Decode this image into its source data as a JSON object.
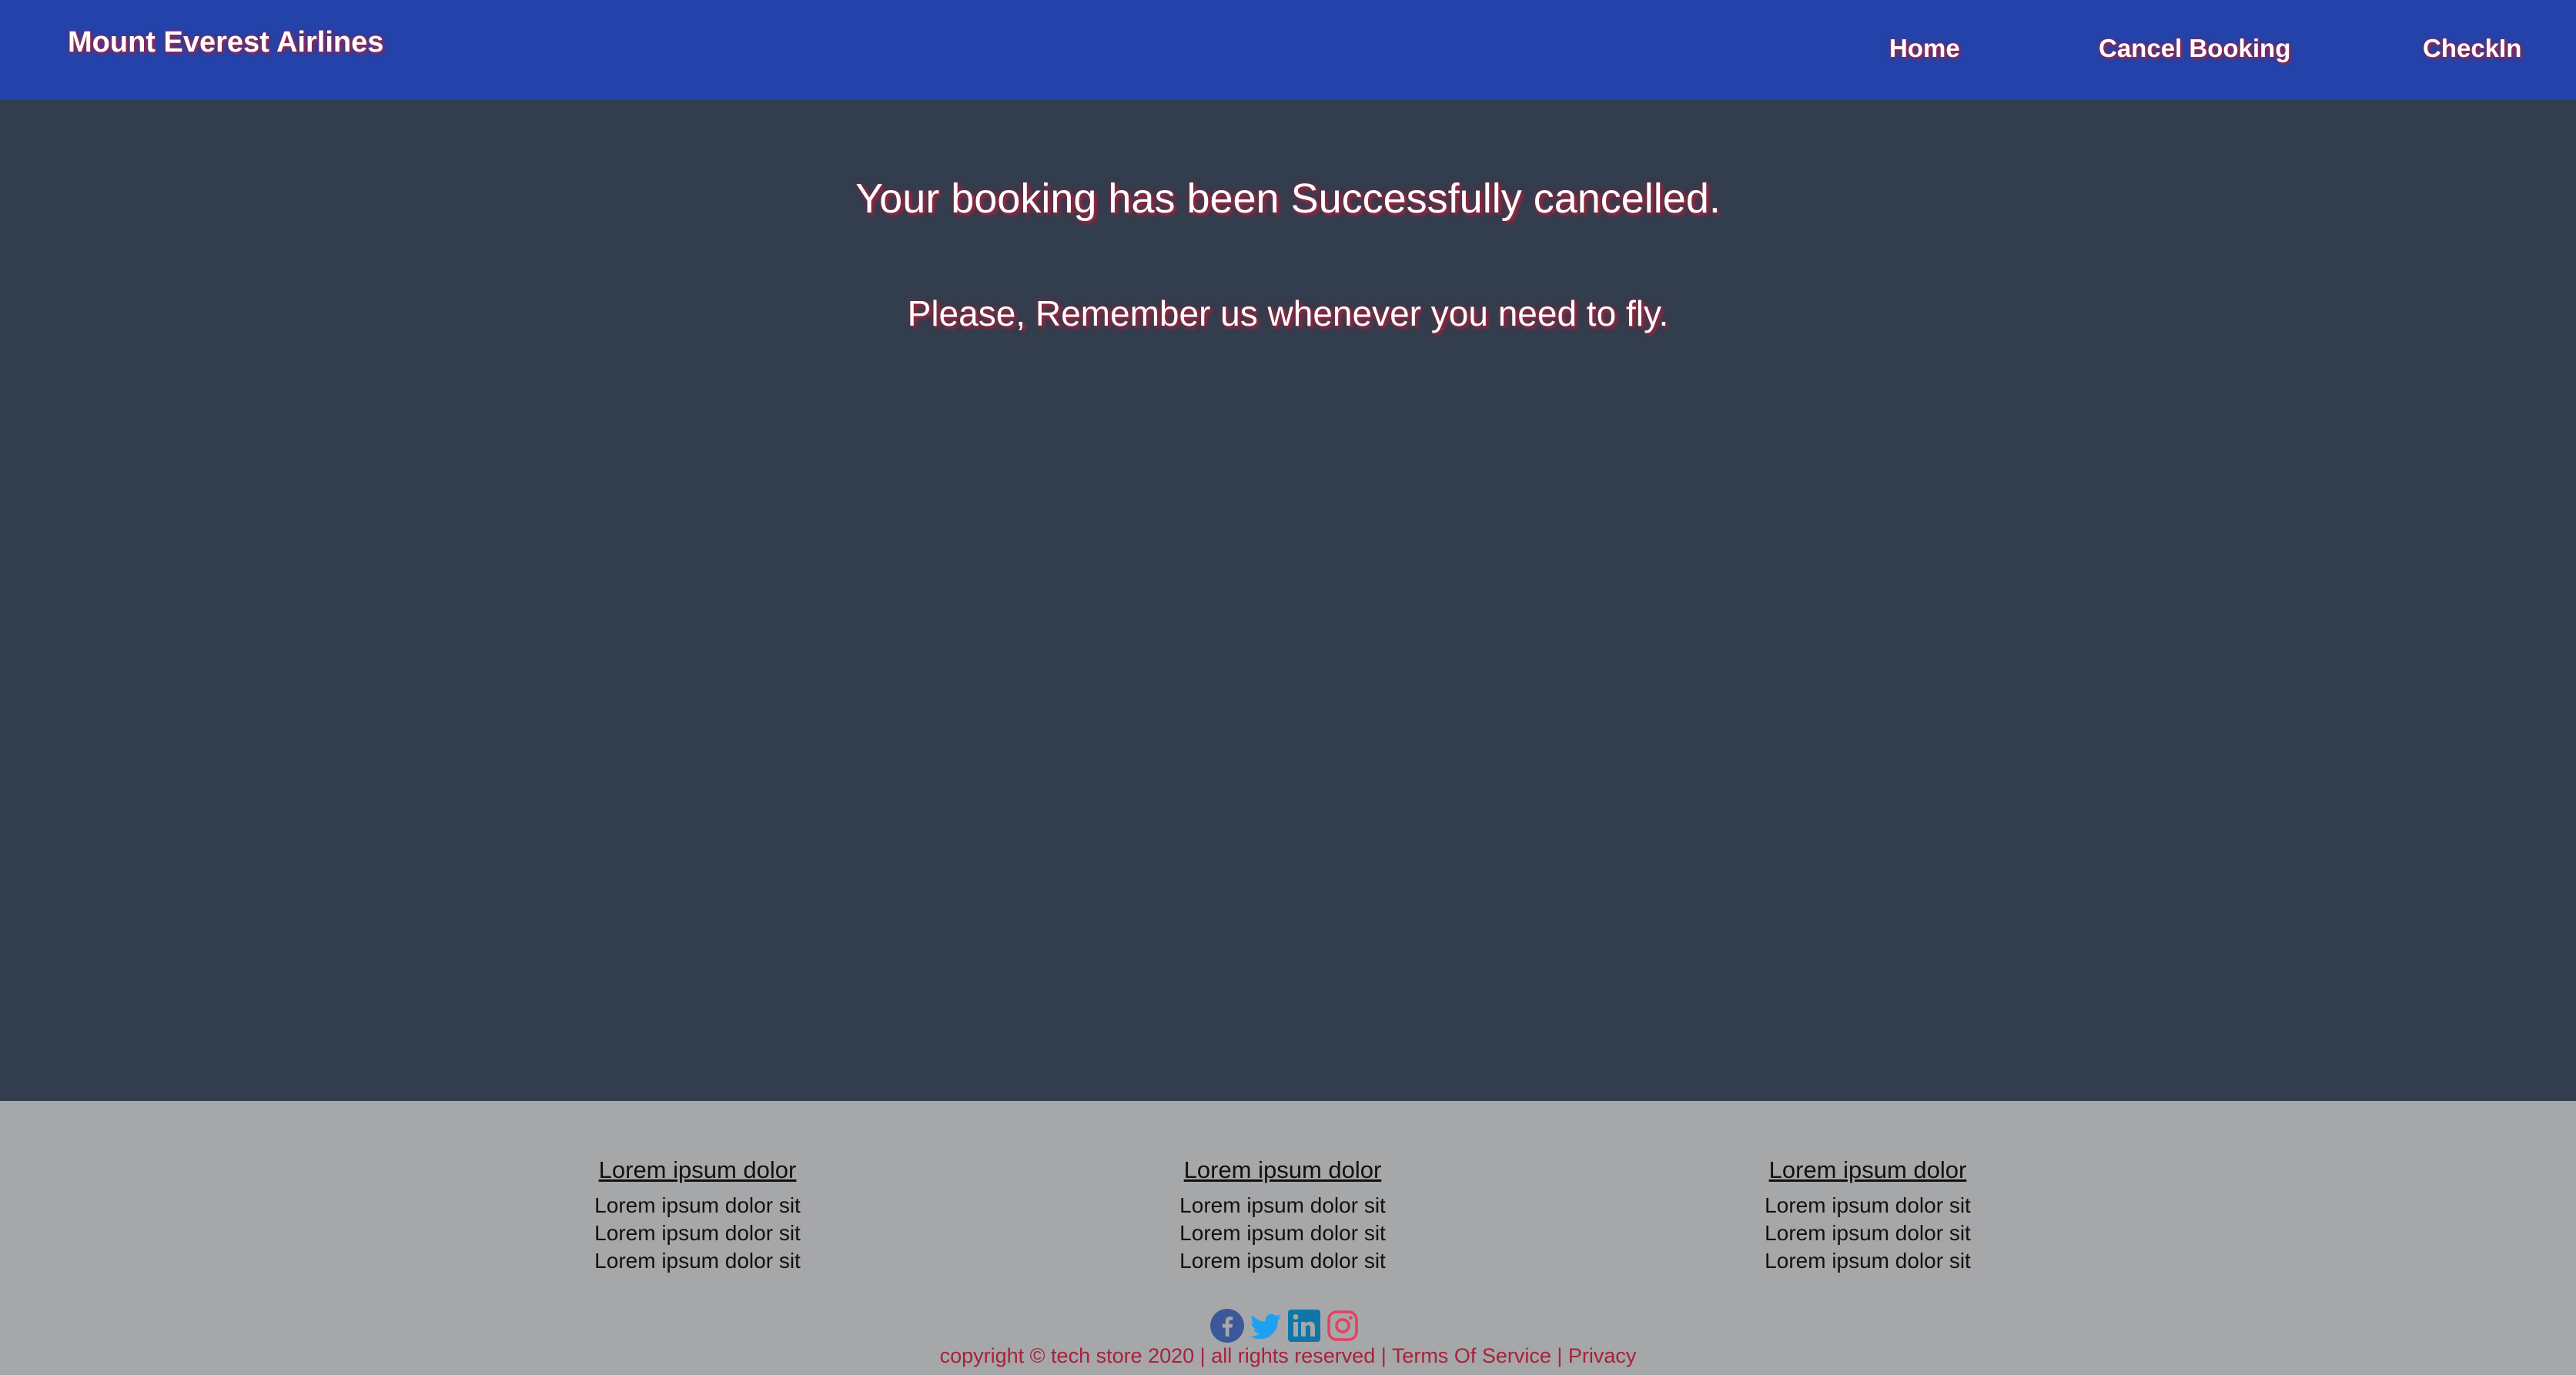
{
  "header": {
    "brand": "Mount Everest Airlines",
    "nav": [
      {
        "label": "Home"
      },
      {
        "label": "Cancel Booking"
      },
      {
        "label": "CheckIn"
      }
    ]
  },
  "main": {
    "headline": "Your booking has been Successfully cancelled.",
    "subline": "Please, Remember us whenever you need to fly."
  },
  "footer": {
    "columns": [
      {
        "heading": "Lorem ipsum dolor",
        "items": [
          "Lorem ipsum dolor sit",
          "Lorem ipsum dolor sit",
          "Lorem ipsum dolor sit"
        ]
      },
      {
        "heading": "Lorem ipsum dolor",
        "items": [
          "Lorem ipsum dolor sit",
          "Lorem ipsum dolor sit",
          "Lorem ipsum dolor sit"
        ]
      },
      {
        "heading": "Lorem ipsum dolor",
        "items": [
          "Lorem ipsum dolor sit",
          "Lorem ipsum dolor sit",
          "Lorem ipsum dolor sit"
        ]
      }
    ],
    "social_icons": [
      "facebook-icon",
      "twitter-icon",
      "linkedin-icon",
      "instagram-icon"
    ],
    "copyright": {
      "text": "copyright © tech store 2020 | all rights reserved | ",
      "terms": "Terms Of Service",
      "separator": " | ",
      "privacy": "Privacy"
    }
  },
  "colors": {
    "navbar": "#2443aa",
    "background": "#323d4e",
    "footer": "#a6a7a9",
    "text_shadow": "#a8213c",
    "copyright": "#a8213c"
  }
}
